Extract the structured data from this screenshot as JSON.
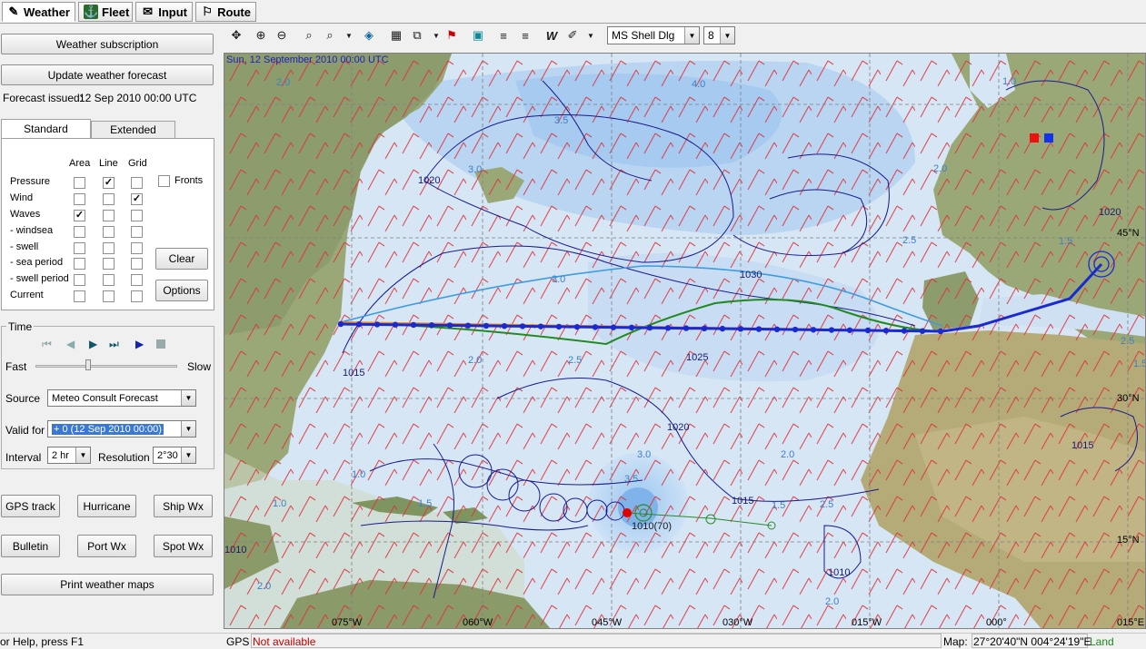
{
  "tabs": [
    {
      "label": "Weather",
      "icon": "weather-icon"
    },
    {
      "label": "Fleet",
      "icon": "fleet-icon"
    },
    {
      "label": "Input",
      "icon": "input-icon"
    },
    {
      "label": "Route",
      "icon": "route-icon"
    }
  ],
  "panel": {
    "weather_subscription": "Weather subscription",
    "update_forecast": "Update weather forecast",
    "forecast_issued_label": "Forecast issued:",
    "forecast_issued_value": "12 Sep 2010 00:00 UTC",
    "subtabs": [
      "Standard",
      "Extended"
    ],
    "columns": [
      "Area",
      "Line",
      "Grid"
    ],
    "rows": [
      {
        "label": "Pressure",
        "area": false,
        "line": true,
        "grid": false
      },
      {
        "label": "Wind",
        "area": false,
        "line": false,
        "grid": true
      },
      {
        "label": "Waves",
        "area": true,
        "line": false,
        "grid": false
      },
      {
        "label": "- windsea",
        "area": false,
        "line": false,
        "grid": false
      },
      {
        "label": "- swell",
        "area": false,
        "line": false,
        "grid": false
      },
      {
        "label": "- sea period",
        "area": false,
        "line": false,
        "grid": false
      },
      {
        "label": "- swell period",
        "area": false,
        "line": false,
        "grid": false
      },
      {
        "label": "Current",
        "area": false,
        "line": false,
        "grid": false
      }
    ],
    "fronts_label": "Fronts",
    "clear": "Clear",
    "options": "Options",
    "time_group": "Time",
    "fast": "Fast",
    "slow": "Slow",
    "source_label": "Source",
    "source_value": "Meteo Consult Forecast",
    "valid_for_label": "Valid for",
    "valid_for_value": "+  0 (12 Sep 2010 00:00)",
    "interval_label": "Interval",
    "interval_value": "2 hr",
    "resolution_label": "Resolution",
    "resolution_value": "2°30",
    "buttons": [
      "GPS track",
      "Hurricane",
      "Ship Wx",
      "Bulletin",
      "Port Wx",
      "Spot Wx"
    ],
    "print": "Print weather maps"
  },
  "toolbar": {
    "font_value": "MS Shell Dlg",
    "font_size_value": "8"
  },
  "map": {
    "timestamp": "Sun, 12 September 2010 00:00 UTC",
    "lon_labels": [
      "075°W",
      "060°W",
      "045°W",
      "030°W",
      "015°W",
      "000°",
      "015°E"
    ],
    "lat_labels": [
      "45°N",
      "30°N",
      "15°N"
    ],
    "isobar_labels": [
      "1020",
      "1015",
      "1030",
      "1025",
      "1020",
      "1015",
      "1010",
      "1020",
      "1015",
      "1010"
    ],
    "wave_labels": [
      "2.0",
      "3.5",
      "4.0",
      "1.0",
      "3.0",
      "2.0",
      "2.5",
      "3.0",
      "2.0",
      "2.5",
      "2.0",
      "1.0",
      "1.5",
      "1.0",
      "2.5",
      "3.0",
      "3.5",
      "2.0",
      "1.5",
      "2.5",
      "1.5",
      "2.0",
      "1.5"
    ],
    "hurricane_label": "1010(70)"
  },
  "status": {
    "help": "or Help, press F1",
    "gps_label": "GPS",
    "gps_value": "Not available",
    "map_label": "Map:",
    "map_coords": "27°20'40\"N 004°24'19\"E",
    "map_type": "Land"
  }
}
